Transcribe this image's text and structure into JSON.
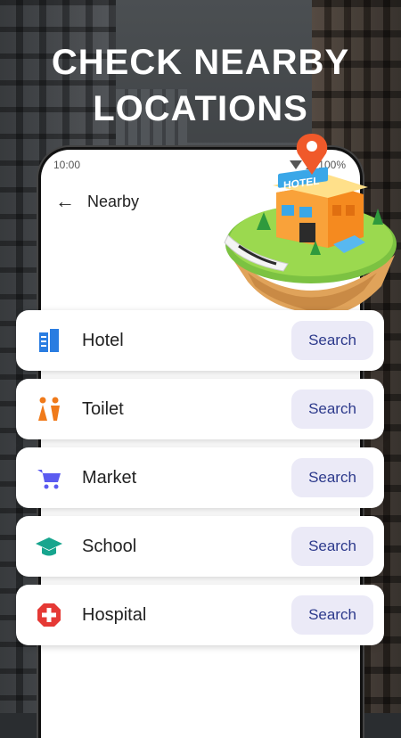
{
  "headline": {
    "line1": "CHECK NEARBY",
    "line2": "LOCATIONS"
  },
  "status_bar": {
    "time": "10:00",
    "battery": "100%"
  },
  "app_bar": {
    "title": "Nearby"
  },
  "illustration": {
    "sign_text": "HOTEL"
  },
  "places": [
    {
      "label": "Hotel",
      "icon": "hotel-icon",
      "color": "#2a7de1",
      "button": "Search"
    },
    {
      "label": "Toilet",
      "icon": "toilet-icon",
      "color": "#f07a1a",
      "button": "Search"
    },
    {
      "label": "Market",
      "icon": "cart-icon",
      "color": "#5b5bf0",
      "button": "Search"
    },
    {
      "label": "School",
      "icon": "graduation-cap-icon",
      "color": "#17a58e",
      "button": "Search"
    },
    {
      "label": "Hospital",
      "icon": "medical-cross-icon",
      "color": "#e53935",
      "button": "Search"
    }
  ]
}
